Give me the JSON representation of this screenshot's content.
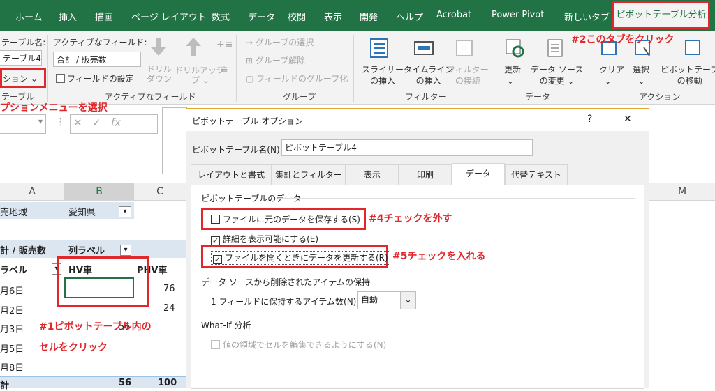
{
  "tabs": [
    "ホーム",
    "挿入",
    "描画",
    "ページ レイアウト",
    "数式",
    "データ",
    "校閲",
    "表示",
    "開発",
    "ヘルプ",
    "Acrobat",
    "Power Pivot",
    "新しいタブ"
  ],
  "active_tab": "ピボットテーブル分析",
  "ribbon": {
    "pt_name_label": "テーブル名:",
    "pt_name_value": "テーブル4",
    "options_btn": "ション",
    "group_pivottable": "テーブル",
    "active_field_label": "アクティブなフィールド:",
    "active_field_value": "合計 / 販売数",
    "field_settings": "フィールドの設定",
    "drilldown": "ドリル\nダウン",
    "drillup": "ドリルアップ",
    "drillup_sub": "プ ⌄",
    "group_active_field": "アクティブなフィールド",
    "group_select": "→ グループの選択",
    "group_ungroup": "グループ解除",
    "group_field": "フィールドのグループ化",
    "group_group": "グループ",
    "slicer": "スライサー\nの挿入",
    "timeline": "タイムライン\nの挿入",
    "filter_conn": "フィルター\nの接続",
    "group_filter": "フィルター",
    "refresh": "更新",
    "datasource": "データ ソース\nの変更 ⌄",
    "group_data": "データ",
    "clear": "クリア",
    "select": "選択",
    "move": "ピボットテーブ\nの移動",
    "group_action": "アクション"
  },
  "annotations": {
    "a2": "#2このタブをクリック",
    "a_option": "プションメニューを選択",
    "a1_line1": "#1ピボットテーブル内の",
    "a1_line2": "セルをクリック",
    "a4": "#4チェックを外す",
    "a5": "#5チェックを入れる"
  },
  "grid": {
    "col_a": "A",
    "col_b": "B",
    "col_c": "C",
    "col_m": "M",
    "r1a": "売地域",
    "r1b": "愛知県",
    "r3a": "計 / 販売数",
    "r3b": "列ラベル",
    "r4a": "ラベル",
    "r4b": "HV車",
    "r4c": "PHV車",
    "rows": [
      {
        "a": "月6日",
        "c": "76"
      },
      {
        "a": "月2日",
        "c": "24"
      },
      {
        "a": "月3日",
        "c": "56"
      },
      {
        "a": "月5日",
        "c": ""
      },
      {
        "a": "月8日",
        "c": ""
      }
    ],
    "total_a": "計",
    "total_b": "56",
    "total_c": "100"
  },
  "dialog": {
    "title": "ピボットテーブル オプション",
    "help": "?",
    "close": "✕",
    "name_label": "ピボットテーブル名(N):",
    "name_value": "ピボットテーブル4",
    "tabs": [
      "レイアウトと書式",
      "集計とフィルター",
      "表示",
      "印刷",
      "データ",
      "代替テキスト"
    ],
    "section_data": "ピボットテーブルのデータ",
    "cb1": "ファイルに元のデータを保存する(S)",
    "cb2": "詳細を表示可能にする(E)",
    "cb3": "ファイルを開くときにデータを更新する(R)",
    "section_retain": "データ ソースから削除されたアイテムの保持",
    "retain_label": "1 フィールドに保持するアイテム数(N):",
    "retain_value": "自動",
    "section_whatif": "What-If 分析",
    "cb4": "値の領域でセルを編集できるようにする(N)"
  }
}
